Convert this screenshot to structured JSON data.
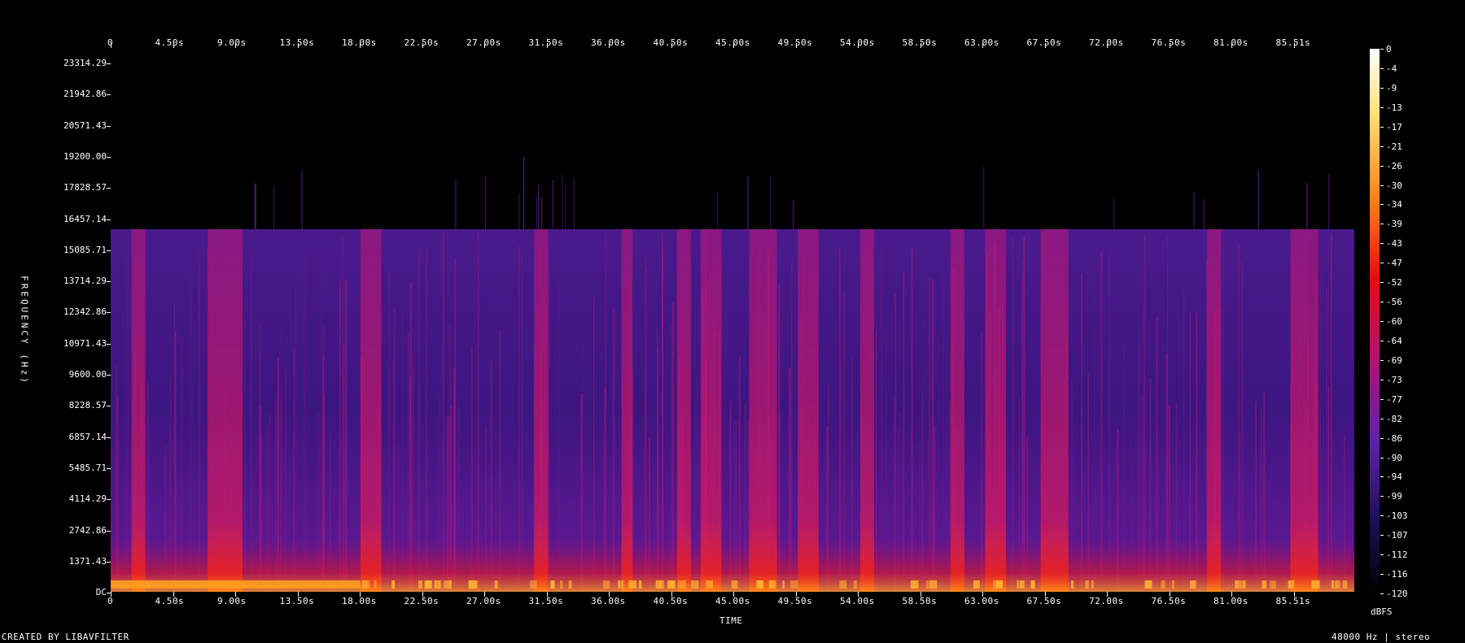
{
  "chart_data": {
    "type": "heatmap",
    "title": "",
    "xlabel": "TIME",
    "ylabel": "FREQUENCY (Hz)",
    "x_ticks": [
      "0",
      "4.50s",
      "9.00s",
      "13.50s",
      "18.00s",
      "22.50s",
      "27.00s",
      "31.50s",
      "36.00s",
      "40.50s",
      "45.00s",
      "49.50s",
      "54.00s",
      "58.50s",
      "63.00s",
      "67.50s",
      "72.00s",
      "76.50s",
      "81.00s",
      "85.51s"
    ],
    "y_ticks": [
      "23314.29",
      "21942.86",
      "20571.43",
      "19200.00",
      "17828.57",
      "16457.14",
      "15085.71",
      "13714.29",
      "12342.86",
      "10971.43",
      "9600.00",
      "8228.57",
      "6857.14",
      "5485.71",
      "4114.29",
      "2742.86",
      "1371.43",
      "DC"
    ],
    "colorbar_label": "dBFS",
    "colorbar_ticks": [
      "0",
      "-4",
      "-9",
      "-13",
      "-17",
      "-21",
      "-26",
      "-30",
      "-34",
      "-39",
      "-43",
      "-47",
      "-52",
      "-56",
      "-60",
      "-64",
      "-69",
      "-73",
      "-77",
      "-82",
      "-86",
      "-90",
      "-94",
      "-99",
      "-103",
      "-107",
      "-112",
      "-116",
      "-120"
    ],
    "xlim": [
      0,
      89.6
    ],
    "ylim": [
      0,
      24000
    ],
    "lowpass_cutoff_hz": 16000,
    "loud_segments_s": [
      [
        1.5,
        2.5
      ],
      [
        7.0,
        9.5
      ],
      [
        18.0,
        19.5
      ],
      [
        30.5,
        31.5
      ],
      [
        36.8,
        37.6
      ],
      [
        40.8,
        41.8
      ],
      [
        42.5,
        44.0
      ],
      [
        46.0,
        48.0
      ],
      [
        49.5,
        51.0
      ],
      [
        54.0,
        55.0
      ],
      [
        60.5,
        61.5
      ],
      [
        63.0,
        64.5
      ],
      [
        67.0,
        69.0
      ],
      [
        79.0,
        80.0
      ],
      [
        85.0,
        87.0
      ]
    ]
  },
  "footer": {
    "credit": "CREATED BY LIBAVFILTER",
    "info": "48000 Hz | stereo"
  }
}
